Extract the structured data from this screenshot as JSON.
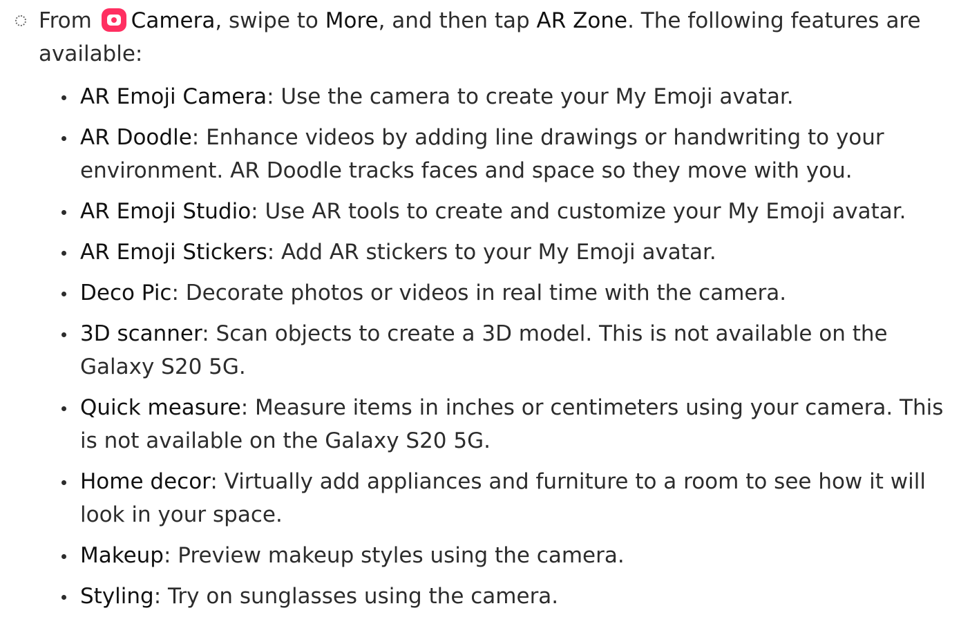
{
  "intro": {
    "prefix": "From ",
    "camera_label": "Camera",
    "text_1": ", swipe to ",
    "more_label": "More",
    "text_2": ", and then tap ",
    "ar_zone_label": "AR Zone",
    "suffix": ". The following features are available:",
    "camera_icon": "camera-icon",
    "step_marker_icon": "dotted-circle-icon",
    "accent_color": "#ff2f61"
  },
  "features": [
    {
      "name": "AR Emoji Camera",
      "desc": ": Use the camera to create your My Emoji avatar."
    },
    {
      "name": "AR Doodle",
      "desc": ": Enhance videos by adding line drawings or handwriting to your environment. AR Doodle tracks faces and space so they move with you."
    },
    {
      "name": "AR Emoji Studio",
      "desc": ": Use AR tools to create and customize your My Emoji avatar."
    },
    {
      "name": "AR Emoji Stickers",
      "desc": ": Add AR stickers to your My Emoji avatar."
    },
    {
      "name": "Deco Pic",
      "desc": ": Decorate photos or videos in real time with the camera."
    },
    {
      "name": "3D scanner",
      "desc": ": Scan objects to create a 3D model. This is not available on the Galaxy S20 5G."
    },
    {
      "name": "Quick measure",
      "desc": ": Measure items in inches or centimeters using your camera. This is not available on the Galaxy S20 5G."
    },
    {
      "name": "Home decor",
      "desc": ": Virtually add appliances and furniture to a room to see how it will look in your space."
    },
    {
      "name": "Makeup",
      "desc": ": Preview makeup styles using the camera."
    },
    {
      "name": "Styling",
      "desc": ": Try on sunglasses using the camera."
    }
  ]
}
